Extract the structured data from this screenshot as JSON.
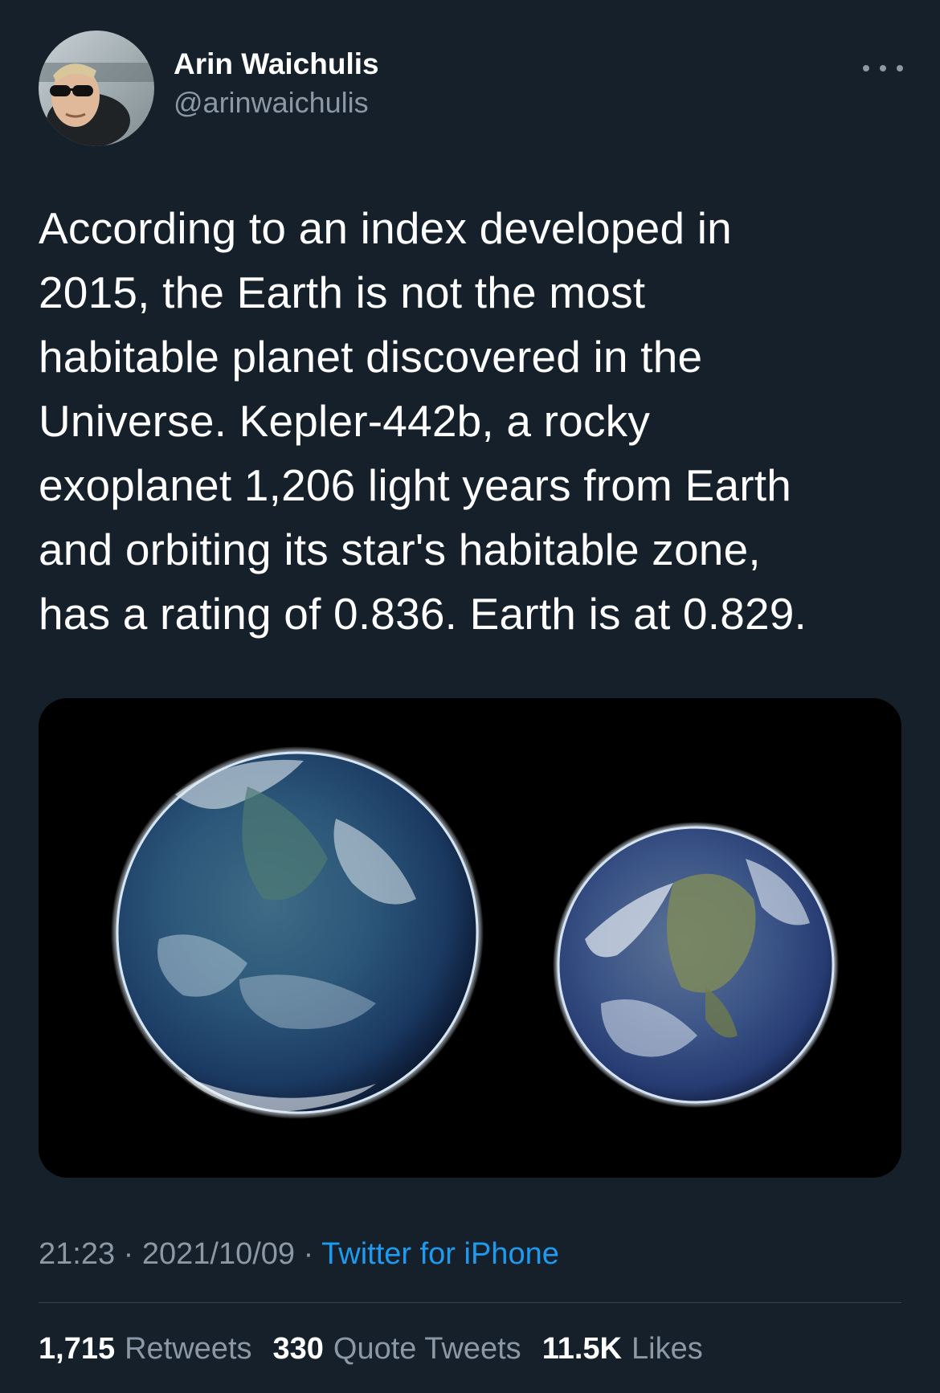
{
  "author": {
    "display_name": "Arin Waichulis",
    "handle": "@arinwaichulis",
    "avatar_icon": "profile-photo"
  },
  "tweet": {
    "text": "According to an index developed in\n2015, the Earth is not the most\nhabitable planet discovered in the\nUniverse. Kepler-442b, a rocky\nexoplanet 1,206 light years from Earth\nand orbiting its star's habitable zone,\nhas a rating of 0.836. Earth is at 0.829."
  },
  "media": {
    "kind": "image",
    "content": "two planets side by side on black background"
  },
  "meta": {
    "time": "21:23",
    "separator": " · ",
    "date": "2021/10/09",
    "source": "Twitter for iPhone"
  },
  "stats": {
    "retweets_count": "1,715",
    "retweets_label": "Retweets",
    "quotes_count": "330",
    "quotes_label": "Quote Tweets",
    "likes_count": "11.5K",
    "likes_label": "Likes"
  },
  "colors": {
    "background": "#15202b",
    "secondary_text": "#8b98a5",
    "link": "#1d9bf0",
    "divider": "#38444d"
  }
}
